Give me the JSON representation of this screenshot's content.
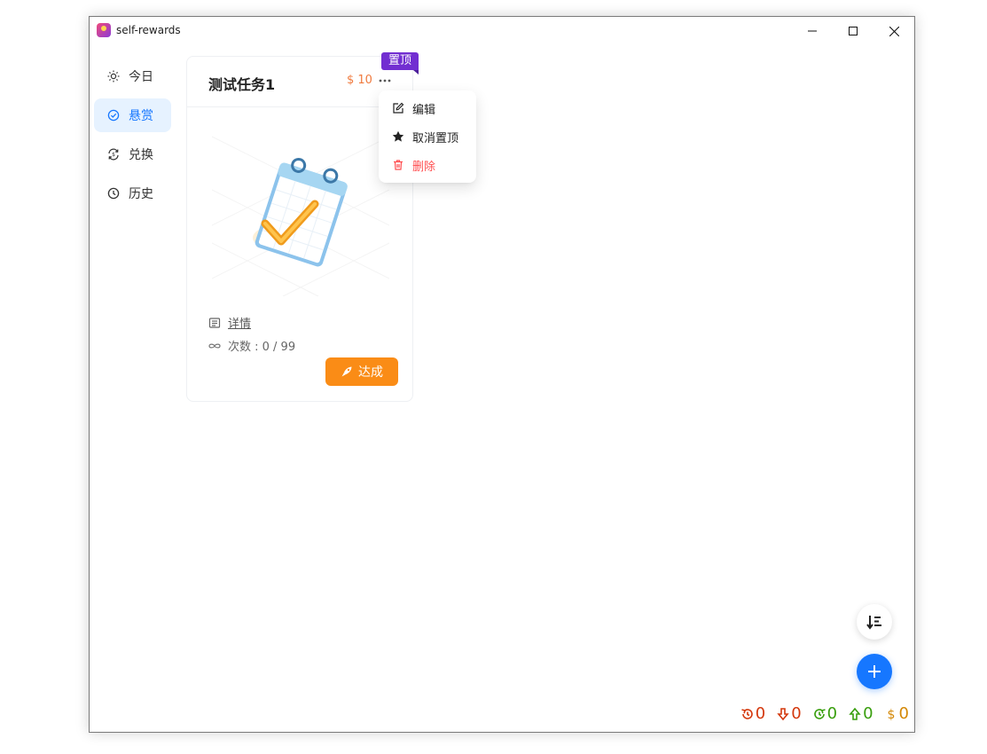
{
  "window": {
    "title": "self-rewards"
  },
  "sidebar": {
    "items": [
      {
        "label": "今日",
        "icon": "sun-icon"
      },
      {
        "label": "悬赏",
        "icon": "check-circle-icon",
        "active": true
      },
      {
        "label": "兑换",
        "icon": "exchange-icon"
      },
      {
        "label": "历史",
        "icon": "history-icon"
      }
    ]
  },
  "task_card": {
    "title": "测试任务1",
    "reward": "$ 10",
    "pin_badge": "置顶",
    "detail_label": "详情",
    "count_label": "次数 : 0 / 99",
    "achieve_label": "达成"
  },
  "context_menu": {
    "items": [
      {
        "label": "编辑",
        "icon": "edit-icon"
      },
      {
        "label": "取消置顶",
        "icon": "star-icon"
      },
      {
        "label": "删除",
        "icon": "trash-icon",
        "danger": true
      }
    ]
  },
  "stats": [
    {
      "icon": "undo-clock-icon",
      "value": "0",
      "color": "#d4380d"
    },
    {
      "icon": "down-arrow-icon",
      "value": "0",
      "color": "#d4380d"
    },
    {
      "icon": "redo-clock-icon",
      "value": "0",
      "color": "#389e0d"
    },
    {
      "icon": "up-arrow-icon",
      "value": "0",
      "color": "#389e0d"
    },
    {
      "icon": "dollar-icon",
      "value": "0",
      "color": "#d48806"
    }
  ],
  "colors": {
    "accent": "#1677ff",
    "active_nav_bg": "#e6f2ff",
    "pin_badge": "#722ed1",
    "reward": "#f07b3f",
    "achieve_button": "#fa8c16",
    "danger": "#ff4d4f"
  }
}
